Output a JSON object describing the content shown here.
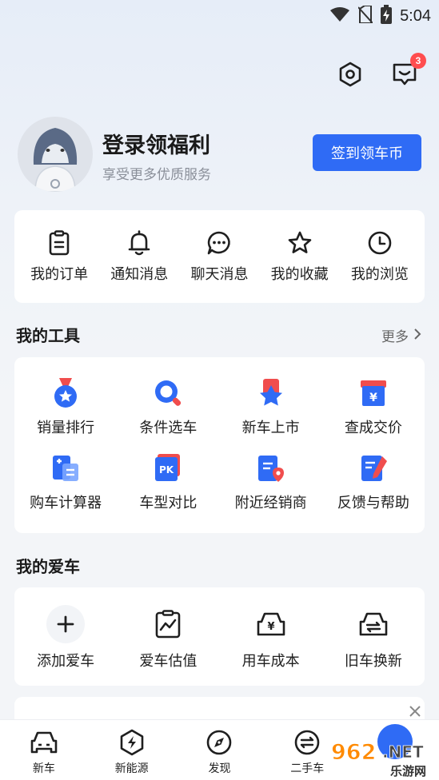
{
  "status_bar": {
    "time": "5:04"
  },
  "header": {
    "message_badge": "3"
  },
  "profile": {
    "title": "登录领福利",
    "subtitle": "享受更多优质服务",
    "signin_button": "签到领车币"
  },
  "quick_actions": [
    {
      "label": "我的订单",
      "icon": "order-icon"
    },
    {
      "label": "通知消息",
      "icon": "bell-icon"
    },
    {
      "label": "聊天消息",
      "icon": "chat-icon"
    },
    {
      "label": "我的收藏",
      "icon": "star-icon"
    },
    {
      "label": "我的浏览",
      "icon": "clock-icon"
    }
  ],
  "tools": {
    "title": "我的工具",
    "more": "更多",
    "items": [
      {
        "label": "销量排行",
        "icon": "medal-icon"
      },
      {
        "label": "条件选车",
        "icon": "magnifier-icon"
      },
      {
        "label": "新车上市",
        "icon": "new-car-icon"
      },
      {
        "label": "查成交价",
        "icon": "price-icon"
      },
      {
        "label": "购车计算器",
        "icon": "calculator-icon"
      },
      {
        "label": "车型对比",
        "icon": "pk-icon"
      },
      {
        "label": "附近经销商",
        "icon": "dealer-icon"
      },
      {
        "label": "反馈与帮助",
        "icon": "feedback-icon"
      }
    ]
  },
  "my_car": {
    "title": "我的爱车",
    "items": [
      {
        "label": "添加爱车",
        "icon": "plus-icon"
      },
      {
        "label": "爱车估值",
        "icon": "valuation-icon"
      },
      {
        "label": "用车成本",
        "icon": "cost-icon"
      },
      {
        "label": "旧车换新",
        "icon": "trade-in-icon"
      }
    ]
  },
  "tabbar": [
    {
      "label": "新车",
      "icon": "car-icon"
    },
    {
      "label": "新能源",
      "icon": "energy-icon"
    },
    {
      "label": "发现",
      "icon": "compass-icon"
    },
    {
      "label": "二手车",
      "icon": "exchange-icon"
    }
  ],
  "watermark": {
    "text": "962.NET",
    "subtext": "乐游网"
  },
  "colors": {
    "accent": "#2f6bf5",
    "badge": "#ff4d4f"
  }
}
